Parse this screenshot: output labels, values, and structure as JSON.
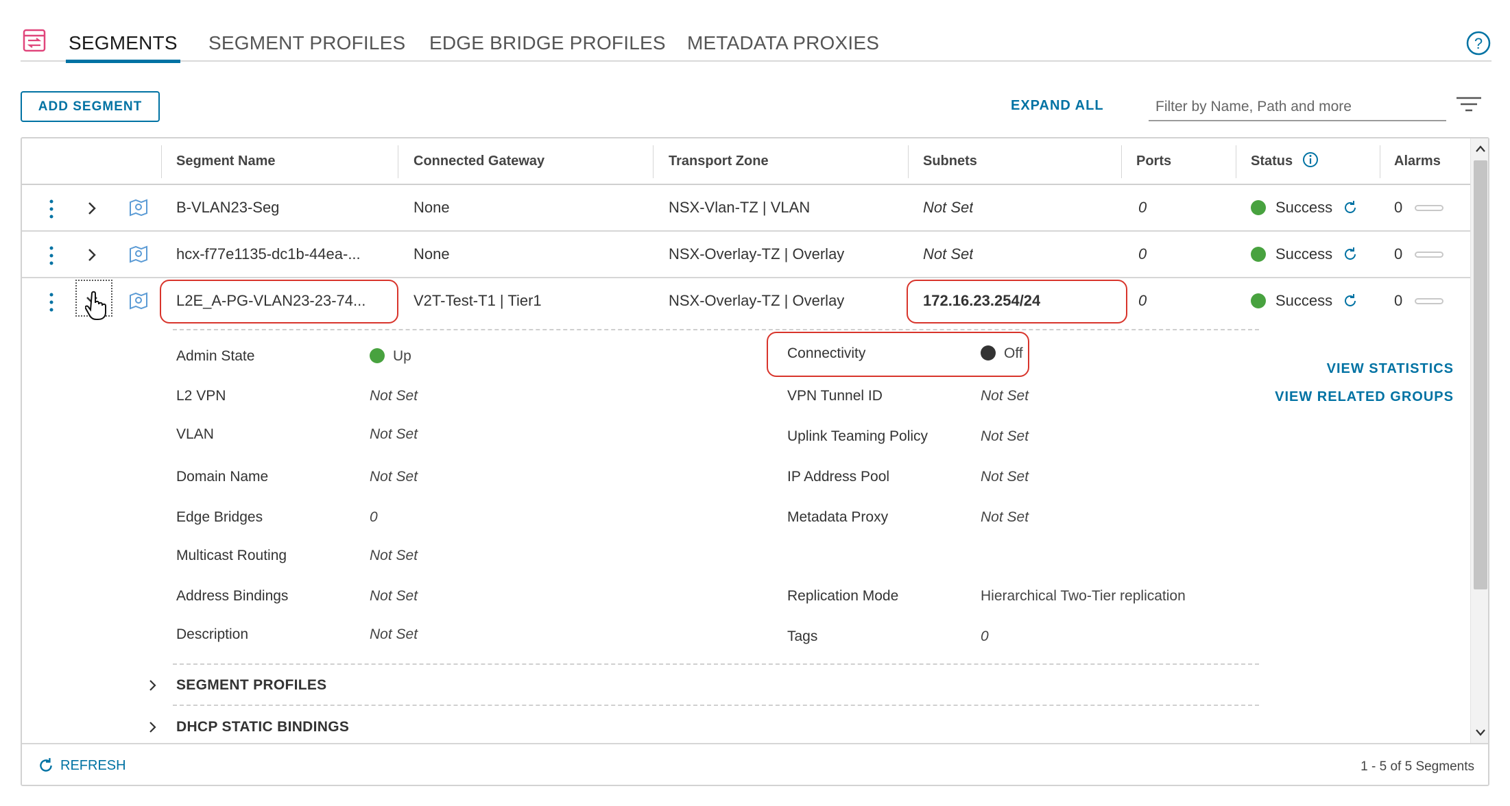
{
  "tabs": [
    {
      "label": "SEGMENTS",
      "active": true
    },
    {
      "label": "SEGMENT PROFILES",
      "active": false
    },
    {
      "label": "EDGE BRIDGE PROFILES",
      "active": false
    },
    {
      "label": "METADATA PROXIES",
      "active": false
    }
  ],
  "toolbar": {
    "add_label": "ADD SEGMENT",
    "expand_all_label": "EXPAND ALL",
    "filter_placeholder": "Filter by Name, Path and more"
  },
  "columns": [
    "Segment Name",
    "Connected Gateway",
    "Transport Zone",
    "Subnets",
    "Ports",
    "Status",
    "Alarms"
  ],
  "rows": [
    {
      "name": "B-VLAN23-Seg",
      "gateway": "None",
      "zone": "NSX-Vlan-TZ | VLAN",
      "subnets": "Not Set",
      "ports": "0",
      "status": "Success",
      "alarms": "0"
    },
    {
      "name": "hcx-f77e1135-dc1b-44ea-...",
      "gateway": "None",
      "zone": "NSX-Overlay-TZ | Overlay",
      "subnets": "Not Set",
      "ports": "0",
      "status": "Success",
      "alarms": "0"
    },
    {
      "name": "L2E_A-PG-VLAN23-23-74...",
      "gateway": "V2T-Test-T1 | Tier1",
      "zone": "NSX-Overlay-TZ | Overlay",
      "subnets": "172.16.23.254/24",
      "ports": "0",
      "status": "Success",
      "alarms": "0"
    }
  ],
  "details": {
    "left": [
      {
        "label": "Admin State",
        "value": "Up"
      },
      {
        "label": "L2 VPN",
        "value": "Not Set"
      },
      {
        "label": "VLAN",
        "value": "Not Set"
      },
      {
        "label": "Domain Name",
        "value": "Not Set"
      },
      {
        "label": "Edge Bridges",
        "value": "0"
      },
      {
        "label": "Multicast Routing",
        "value": "Not Set"
      },
      {
        "label": "Address Bindings",
        "value": "Not Set"
      },
      {
        "label": "Description",
        "value": "Not Set"
      }
    ],
    "right": [
      {
        "label": "Connectivity",
        "value": "Off"
      },
      {
        "label": "VPN Tunnel ID",
        "value": "Not Set"
      },
      {
        "label": "Uplink Teaming Policy",
        "value": "Not Set"
      },
      {
        "label": "IP Address Pool",
        "value": "Not Set"
      },
      {
        "label": "Metadata Proxy",
        "value": "Not Set"
      },
      {
        "label": "Replication Mode",
        "value": "Hierarchical Two-Tier replication"
      },
      {
        "label": "Tags",
        "value": "0"
      }
    ],
    "links": {
      "view_statistics": "VIEW STATISTICS",
      "view_related_groups": "VIEW RELATED GROUPS"
    },
    "sections": [
      "SEGMENT PROFILES",
      "DHCP STATIC BINDINGS"
    ]
  },
  "footer": {
    "refresh_label": "REFRESH",
    "pager": "1 - 5 of 5 Segments"
  },
  "colors": {
    "accent": "#0072a3",
    "success": "#48a23f",
    "highlight": "#d8342b"
  }
}
